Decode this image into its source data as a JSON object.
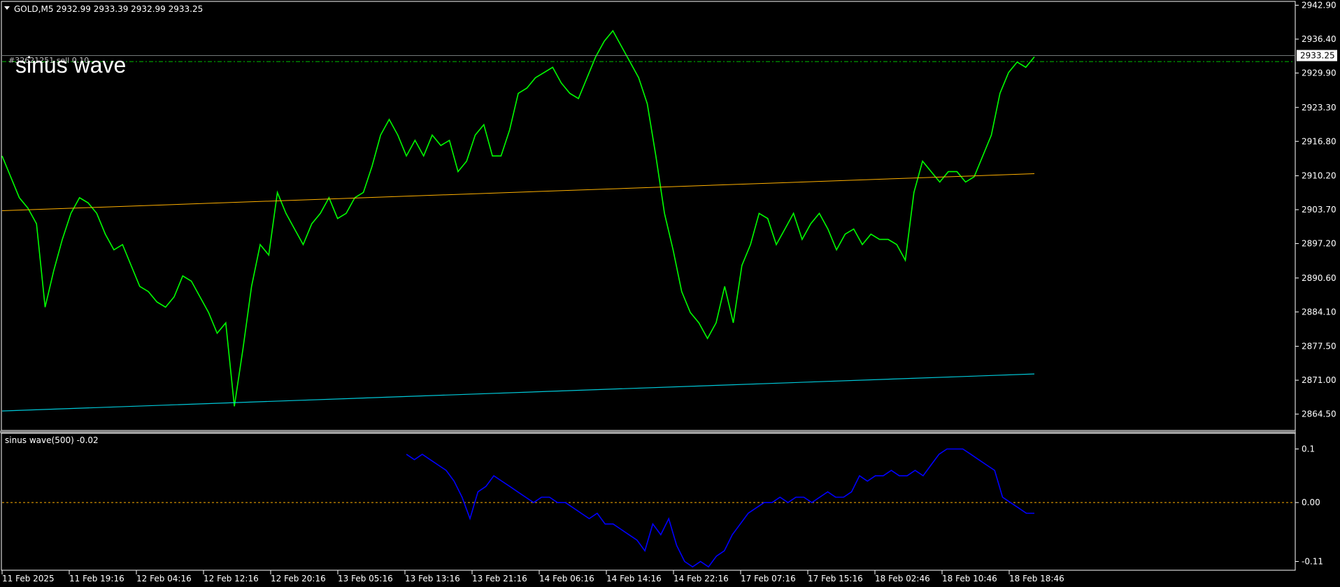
{
  "header": {
    "symbol_line": "GOLD,M5  2932.99 2933.39 2932.99 2933.25",
    "overlay_title": "sinus wave",
    "order_label": "#32621251 sell 0.10"
  },
  "indicator": {
    "label": "sinus wave(500) -0.02"
  },
  "colors": {
    "background": "#000000",
    "price": "#00ff00",
    "indicator": "#0000ff",
    "upper_line": "#ffb000",
    "lower_line": "#00c8d8",
    "order_line": "#00c000",
    "zero_line": "#ffb000",
    "axis": "#ffffff"
  },
  "chart_data": [
    {
      "type": "line",
      "title": "GOLD,M5",
      "last_price_label": "2933.25",
      "ylim": [
        2861.5,
        2943.5
      ],
      "y_ticks": [
        "2942.90",
        "2936.40",
        "2929.90",
        "2923.30",
        "2916.80",
        "2910.20",
        "2903.70",
        "2897.20",
        "2890.60",
        "2884.10",
        "2877.50",
        "2871.00",
        "2864.50"
      ],
      "x_ticks": [
        "11 Feb 2025",
        "11 Feb 19:16",
        "12 Feb 04:16",
        "12 Feb 12:16",
        "12 Feb 20:16",
        "13 Feb 05:16",
        "13 Feb 13:16",
        "13 Feb 21:16",
        "14 Feb 06:16",
        "14 Feb 14:16",
        "14 Feb 22:16",
        "17 Feb 07:16",
        "17 Feb 15:16",
        "18 Feb 02:46",
        "18 Feb 10:46",
        "18 Feb 18:46"
      ],
      "series": [
        {
          "values": [
            2914,
            2910,
            2906,
            2904,
            2901,
            2885,
            2892,
            2898,
            2903,
            2906,
            2905,
            2903,
            2899,
            2896,
            2897,
            2893,
            2889,
            2888,
            2886,
            2885,
            2887,
            2891,
            2890,
            2887,
            2884,
            2880,
            2882,
            2866,
            2877,
            2889,
            2897,
            2895,
            2907,
            2903,
            2900,
            2897,
            2901,
            2903,
            2906,
            2902,
            2903,
            2906,
            2907,
            2912,
            2918,
            2921,
            2918,
            2914,
            2917,
            2914,
            2918,
            2916,
            2917,
            2911,
            2913,
            2918,
            2920,
            2914,
            2914,
            2919,
            2926,
            2927,
            2929,
            2930,
            2931,
            2928,
            2926,
            2925,
            2929,
            2933,
            2936,
            2938,
            2935,
            2932,
            2929,
            2924,
            2914,
            2903,
            2896,
            2888,
            2884,
            2882,
            2879,
            2882,
            2889,
            2882,
            2893,
            2897,
            2903,
            2902,
            2897,
            2900,
            2903,
            2898,
            2901,
            2903,
            2900,
            2896,
            2899,
            2900,
            2897,
            2899,
            2898,
            2898,
            2897,
            2894,
            2907,
            2913,
            2911,
            2909,
            2911,
            2911,
            2909,
            2910,
            2914,
            2918,
            2926,
            2930,
            2932,
            2931,
            2933
          ]
        },
        {
          "name": "",
          "values": [
            2903.5,
            2910.6
          ]
        },
        {
          "values": [
            2865.1,
            2872.2
          ]
        }
      ],
      "order_level": 2932.1
    },
    {
      "type": "line",
      "title": "sinus wave(500) -0.02",
      "ylim": [
        -0.125,
        0.128
      ],
      "y_ticks": [
        "0.1",
        "0.00",
        "-0.11"
      ],
      "zero_line": 0.0,
      "start_index": 47,
      "series": [
        {
          "values": [
            0.09,
            0.08,
            0.09,
            0.08,
            0.07,
            0.06,
            0.04,
            0.01,
            -0.03,
            0.02,
            0.03,
            0.05,
            0.04,
            0.03,
            0.02,
            0.01,
            0.0,
            0.01,
            0.01,
            0.0,
            0.0,
            -0.01,
            -0.02,
            -0.03,
            -0.02,
            -0.04,
            -0.04,
            -0.05,
            -0.06,
            -0.07,
            -0.09,
            -0.04,
            -0.06,
            -0.03,
            -0.08,
            -0.11,
            -0.12,
            -0.11,
            -0.12,
            -0.1,
            -0.09,
            -0.06,
            -0.04,
            -0.02,
            -0.01,
            0.0,
            0.0,
            0.01,
            0.0,
            0.01,
            0.01,
            0.0,
            0.01,
            0.02,
            0.01,
            0.01,
            0.02,
            0.05,
            0.04,
            0.05,
            0.05,
            0.06,
            0.05,
            0.05,
            0.06,
            0.05,
            0.07,
            0.09,
            0.1,
            0.1,
            0.1,
            0.09,
            0.08,
            0.07,
            0.06,
            0.01,
            0.0,
            -0.01,
            -0.02,
            -0.02
          ]
        }
      ]
    }
  ]
}
